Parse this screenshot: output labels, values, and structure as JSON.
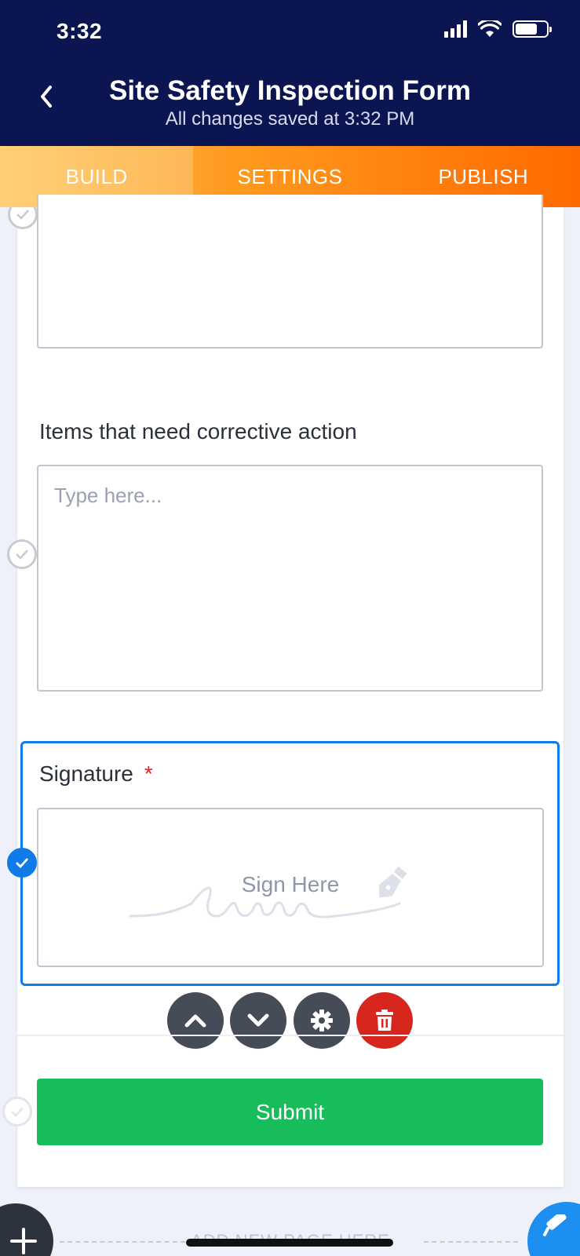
{
  "status_bar": {
    "time": "3:32"
  },
  "header": {
    "title": "Site Safety Inspection Form",
    "subtitle": "All changes saved at 3:32 PM"
  },
  "tabs": [
    {
      "label": "BUILD",
      "active": true
    },
    {
      "label": "SETTINGS",
      "active": false
    },
    {
      "label": "PUBLISH",
      "active": false
    }
  ],
  "form": {
    "corrective_action": {
      "label": "Items that need corrective action",
      "placeholder": "Type here..."
    },
    "signature": {
      "label": "Signature",
      "required_mark": "*",
      "prompt": "Sign Here"
    },
    "submit_label": "Submit"
  },
  "footer": {
    "add_page_label": "ADD NEW PAGE HERE"
  },
  "colors": {
    "header_bg": "#0a1551",
    "accent_orange": "#ff6a00",
    "selected_blue": "#0e7be8",
    "submit_green": "#18bd5b",
    "delete_red": "#d6261e"
  }
}
